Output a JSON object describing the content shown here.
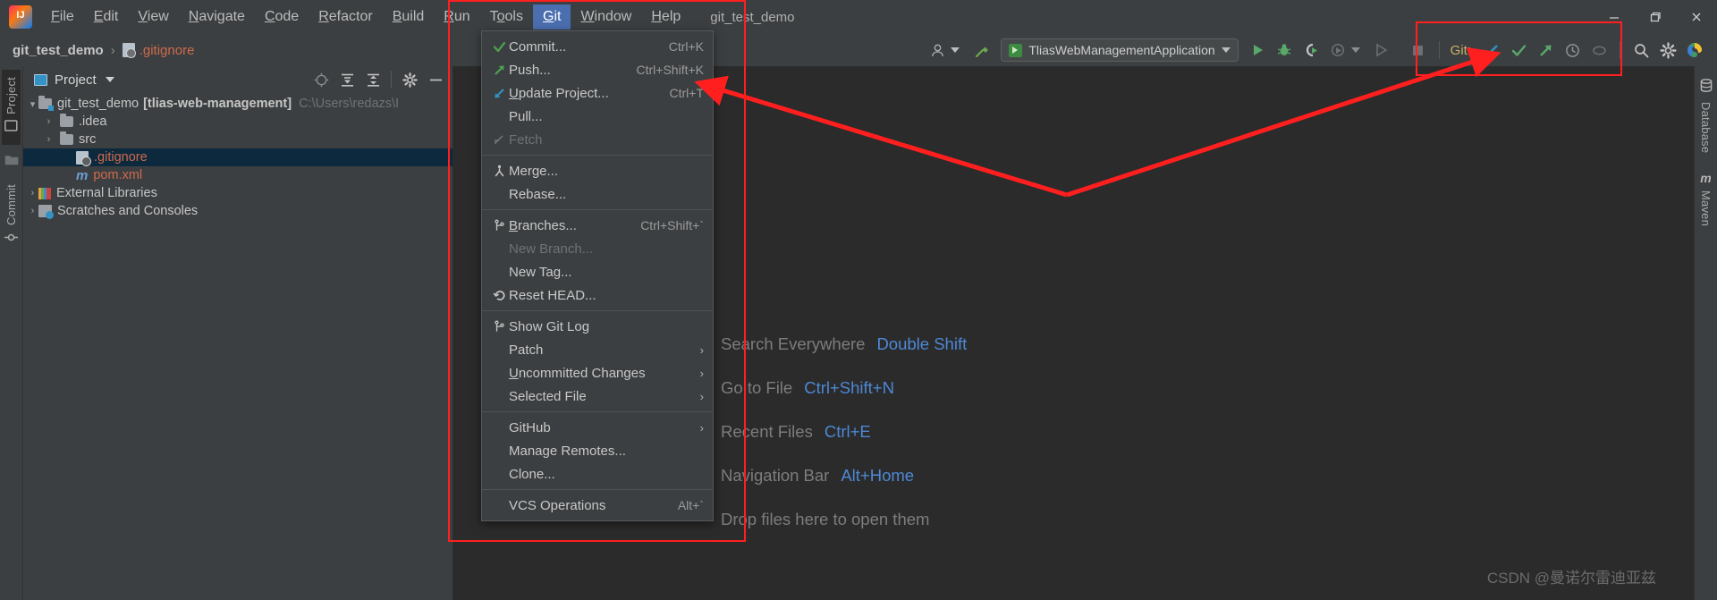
{
  "window": {
    "title": "git_test_demo",
    "controls": [
      "minimize",
      "restore",
      "close"
    ]
  },
  "menubar": {
    "logo": "intellij-idea-logo",
    "items": [
      {
        "label": "File",
        "mnemonic": "F",
        "active": false
      },
      {
        "label": "Edit",
        "mnemonic": "E",
        "active": false
      },
      {
        "label": "View",
        "mnemonic": "V",
        "active": false
      },
      {
        "label": "Navigate",
        "mnemonic": "N",
        "active": false
      },
      {
        "label": "Code",
        "mnemonic": "C",
        "active": false
      },
      {
        "label": "Refactor",
        "mnemonic": "R",
        "active": false
      },
      {
        "label": "Build",
        "mnemonic": "B",
        "active": false
      },
      {
        "label": "Run",
        "mnemonic": "R",
        "active": false
      },
      {
        "label": "Tools",
        "mnemonic": "T",
        "active": false
      },
      {
        "label": "Git",
        "mnemonic": "G",
        "active": true
      },
      {
        "label": "Window",
        "mnemonic": "W",
        "active": false
      },
      {
        "label": "Help",
        "mnemonic": "H",
        "active": false
      }
    ]
  },
  "git_menu": {
    "items": [
      {
        "label": "Commit...",
        "mnemonic": "i",
        "shortcut": "Ctrl+K",
        "icon": "green-check-icon",
        "disabled": false,
        "submenu": false
      },
      {
        "label": "Push...",
        "mnemonic": "",
        "shortcut": "Ctrl+Shift+K",
        "icon": "green-up-arrow-icon",
        "disabled": false,
        "submenu": false
      },
      {
        "label": "Update Project...",
        "mnemonic": "U",
        "shortcut": "Ctrl+T",
        "icon": "blue-down-arrow-icon",
        "disabled": false,
        "submenu": false
      },
      {
        "label": "Pull...",
        "mnemonic": "",
        "shortcut": "",
        "icon": "",
        "disabled": false,
        "submenu": false
      },
      {
        "label": "Fetch",
        "mnemonic": "",
        "shortcut": "",
        "icon": "fetch-arrow-icon",
        "disabled": true,
        "submenu": false
      },
      {
        "separator": true
      },
      {
        "label": "Merge...",
        "mnemonic": "",
        "shortcut": "",
        "icon": "merge-icon",
        "disabled": false,
        "submenu": false
      },
      {
        "label": "Rebase...",
        "mnemonic": "",
        "shortcut": "",
        "icon": "",
        "disabled": false,
        "submenu": false
      },
      {
        "separator": true
      },
      {
        "label": "Branches...",
        "mnemonic": "B",
        "shortcut": "Ctrl+Shift+`",
        "icon": "branch-icon",
        "disabled": false,
        "submenu": false
      },
      {
        "label": "New Branch...",
        "mnemonic": "",
        "shortcut": "",
        "icon": "",
        "disabled": true,
        "submenu": false
      },
      {
        "label": "New Tag...",
        "mnemonic": "",
        "shortcut": "",
        "icon": "",
        "disabled": false,
        "submenu": false
      },
      {
        "label": "Reset HEAD...",
        "mnemonic": "",
        "shortcut": "",
        "icon": "reset-icon",
        "disabled": false,
        "submenu": false
      },
      {
        "separator": true
      },
      {
        "label": "Show Git Log",
        "mnemonic": "",
        "shortcut": "",
        "icon": "branch-icon",
        "disabled": false,
        "submenu": false
      },
      {
        "label": "Patch",
        "mnemonic": "",
        "shortcut": "",
        "icon": "",
        "disabled": false,
        "submenu": true
      },
      {
        "label": "Uncommitted Changes",
        "mnemonic": "U",
        "shortcut": "",
        "icon": "",
        "disabled": false,
        "submenu": true
      },
      {
        "label": "Selected File",
        "mnemonic": "",
        "shortcut": "",
        "icon": "",
        "disabled": false,
        "submenu": true
      },
      {
        "separator": true
      },
      {
        "label": "GitHub",
        "mnemonic": "",
        "shortcut": "",
        "icon": "",
        "disabled": false,
        "submenu": true
      },
      {
        "label": "Manage Remotes...",
        "mnemonic": "",
        "shortcut": "",
        "icon": "",
        "disabled": false,
        "submenu": false
      },
      {
        "label": "Clone...",
        "mnemonic": "",
        "shortcut": "",
        "icon": "",
        "disabled": false,
        "submenu": false
      },
      {
        "separator": true
      },
      {
        "label": "VCS Operations",
        "mnemonic": "",
        "shortcut": "Alt+`",
        "icon": "",
        "disabled": false,
        "submenu": false
      }
    ]
  },
  "breadcrumb": {
    "project": "git_test_demo",
    "separator": "›",
    "file": ".gitignore"
  },
  "toolbar": {
    "run_config": "TliasWebManagementApplication",
    "git_label": "Git:",
    "icons": [
      "user-avatar-icon",
      "hammer-build-icon",
      "run-icon",
      "debug-icon",
      "run-coverage-icon",
      "profiler-icon",
      "run-selected-icon",
      "stop-icon",
      "search-icon",
      "gear-icon",
      "theme-icon"
    ],
    "git_actions": [
      "update-project-icon",
      "commit-icon",
      "push-icon",
      "history-icon",
      "branch-icon"
    ]
  },
  "left_stripe": {
    "items": [
      {
        "label": "Project",
        "icon": "project-icon"
      },
      {
        "label": "",
        "icon": "folder-icon"
      },
      {
        "label": "Commit",
        "icon": "commit-icon"
      }
    ]
  },
  "right_stripe": {
    "items": [
      {
        "label": "Database",
        "icon": "database-icon"
      },
      {
        "label": "Maven",
        "icon": "maven-icon"
      }
    ]
  },
  "project_panel": {
    "title": "Project",
    "title_icon": "project-view-icon",
    "tools": [
      "locate-icon",
      "expand-all-icon",
      "collapse-all-icon",
      "gear-icon",
      "hide-icon"
    ],
    "tree": [
      {
        "indent": 0,
        "arrow": "⌄",
        "icon": "module-folder-icon",
        "name": "git_test_demo",
        "bold_suffix": "[tlias-web-management]",
        "path": "C:\\Users\\redazs\\I",
        "color": "default",
        "selected": false
      },
      {
        "indent": 1,
        "arrow": "›",
        "icon": "folder-icon",
        "name": ".idea",
        "bold_suffix": "",
        "path": "",
        "color": "default",
        "selected": false
      },
      {
        "indent": 1,
        "arrow": "›",
        "icon": "folder-icon",
        "name": "src",
        "bold_suffix": "",
        "path": "",
        "color": "default",
        "selected": false
      },
      {
        "indent": 2,
        "arrow": "",
        "icon": "gitignore-file-icon",
        "name": ".gitignore",
        "bold_suffix": "",
        "path": "",
        "color": "red",
        "selected": true
      },
      {
        "indent": 2,
        "arrow": "",
        "icon": "maven-pom-icon",
        "name": "pom.xml",
        "bold_suffix": "",
        "path": "",
        "color": "red",
        "selected": false
      },
      {
        "indent": 0,
        "arrow": "›",
        "icon": "libraries-icon",
        "name": "External Libraries",
        "bold_suffix": "",
        "path": "",
        "color": "default",
        "selected": false
      },
      {
        "indent": 0,
        "arrow": "›",
        "icon": "scratches-icon",
        "name": "Scratches and Consoles",
        "bold_suffix": "",
        "path": "",
        "color": "default",
        "selected": false
      }
    ]
  },
  "editor_hints": [
    {
      "label": "Search Everywhere",
      "key": "Double Shift"
    },
    {
      "label": "Go to File",
      "key": "Ctrl+Shift+N"
    },
    {
      "label": "Recent Files",
      "key": "Ctrl+E"
    },
    {
      "label": "Navigation Bar",
      "key": "Alt+Home"
    },
    {
      "label": "Drop files here to open them",
      "key": ""
    }
  ],
  "watermark": "CSDN @曼诺尔雷迪亚兹",
  "annotation": {
    "color": "#ff1f1f",
    "shapes": [
      "menu-highlight-box",
      "git-toolbar-highlight-box",
      "arrow-to-git-menu",
      "arrow-to-git-toolbar"
    ]
  },
  "colors": {
    "accent_blue": "#4d88d6",
    "menu_active": "#4b6eaf",
    "selection": "#0d293e",
    "file_red": "#cf6a4c",
    "annotation_red": "#ff1f1f",
    "bg_panel": "#3c3f41",
    "bg_editor": "#2b2b2b"
  }
}
